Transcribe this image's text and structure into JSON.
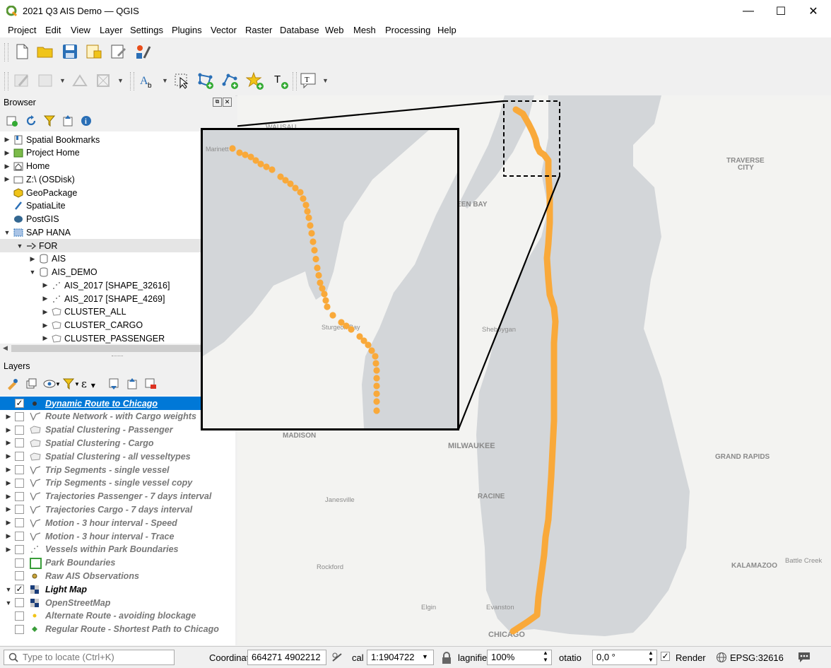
{
  "window": {
    "title": "2021 Q3 AIS Demo — QGIS",
    "minimize": "—",
    "maximize": "☐",
    "close": "✕"
  },
  "menu": [
    "Project",
    "Edit",
    "View",
    "Layer",
    "Settings",
    "Plugins",
    "Vector",
    "Raster",
    "Database",
    "Web",
    "Mesh",
    "Processing",
    "Help"
  ],
  "browser": {
    "title": "Browser",
    "items": [
      {
        "label": "Spatial Bookmarks",
        "icon": "bookmark-icon",
        "expander": "▶",
        "indent": 0
      },
      {
        "label": "Project Home",
        "icon": "project-home-icon",
        "expander": "▶",
        "indent": 0
      },
      {
        "label": "Home",
        "icon": "home-folder-icon",
        "expander": "▶",
        "indent": 0
      },
      {
        "label": "Z:\\ (OSDisk)",
        "icon": "drive-icon",
        "expander": "▶",
        "indent": 0
      },
      {
        "label": "GeoPackage",
        "icon": "geopackage-icon",
        "expander": "",
        "indent": 0
      },
      {
        "label": "SpatiaLite",
        "icon": "spatialite-icon",
        "expander": "",
        "indent": 0
      },
      {
        "label": "PostGIS",
        "icon": "postgis-icon",
        "expander": "",
        "indent": 0
      },
      {
        "label": "SAP HANA",
        "icon": "sap-hana-icon",
        "expander": "▼",
        "indent": 0
      },
      {
        "label": "FOR",
        "icon": "connection-icon",
        "expander": "▼",
        "indent": 1
      },
      {
        "label": "AIS",
        "icon": "schema-icon",
        "expander": "▶",
        "indent": 2
      },
      {
        "label": "AIS_DEMO",
        "icon": "schema-icon",
        "expander": "▼",
        "indent": 2
      },
      {
        "label": "AIS_2017 [SHAPE_32616]",
        "icon": "point-layer-icon",
        "expander": "▶",
        "indent": 3
      },
      {
        "label": "AIS_2017 [SHAPE_4269]",
        "icon": "point-layer-icon",
        "expander": "▶",
        "indent": 3
      },
      {
        "label": "CLUSTER_ALL",
        "icon": "polygon-layer-icon",
        "expander": "▶",
        "indent": 3
      },
      {
        "label": "CLUSTER_CARGO",
        "icon": "polygon-layer-icon",
        "expander": "▶",
        "indent": 3
      },
      {
        "label": "CLUSTER_PASSENGER",
        "icon": "polygon-layer-icon",
        "expander": "▶",
        "indent": 3
      }
    ]
  },
  "layers": {
    "title": "Layers",
    "items": [
      {
        "label": "Dynamic Route to Chicago",
        "checked": true,
        "expander": "",
        "icon": "point-symbol-icon",
        "state": "sel"
      },
      {
        "label": "Route Network - with Cargo weights",
        "checked": false,
        "expander": "▶",
        "icon": "line-icon",
        "state": "off"
      },
      {
        "label": "Spatial Clustering - Passenger",
        "checked": false,
        "expander": "▶",
        "icon": "polygon-icon",
        "state": "off"
      },
      {
        "label": "Spatial Clustering - Cargo",
        "checked": false,
        "expander": "▶",
        "icon": "polygon-icon",
        "state": "off"
      },
      {
        "label": "Spatial Clustering - all vesseltypes",
        "checked": false,
        "expander": "▶",
        "icon": "polygon-icon",
        "state": "off"
      },
      {
        "label": "Trip Segments - single vessel",
        "checked": false,
        "expander": "▶",
        "icon": "line-icon",
        "state": "off"
      },
      {
        "label": "Trip Segments - single vessel copy",
        "checked": false,
        "expander": "▶",
        "icon": "line-icon",
        "state": "off"
      },
      {
        "label": "Trajectories Passenger - 7 days interval",
        "checked": false,
        "expander": "▶",
        "icon": "line-icon",
        "state": "off"
      },
      {
        "label": "Trajectories Cargo - 7 days interval",
        "checked": false,
        "expander": "▶",
        "icon": "line-icon",
        "state": "off"
      },
      {
        "label": "Motion - 3 hour interval - Speed",
        "checked": false,
        "expander": "▶",
        "icon": "line-icon",
        "state": "off"
      },
      {
        "label": "Motion - 3 hour interval - Trace",
        "checked": false,
        "expander": "▶",
        "icon": "line-icon",
        "state": "off"
      },
      {
        "label": "Vessels within Park Boundaries",
        "checked": false,
        "expander": "▶",
        "icon": "points-icon",
        "state": "off"
      },
      {
        "label": "Park Boundaries",
        "checked": false,
        "expander": "",
        "icon": "green-square-icon",
        "state": "off"
      },
      {
        "label": "Raw AIS Observations",
        "checked": false,
        "expander": "",
        "icon": "brown-dot-icon",
        "state": "off"
      },
      {
        "label": "Light Map",
        "checked": true,
        "expander": "▼",
        "icon": "raster-icon",
        "state": "on"
      },
      {
        "label": "OpenStreetMap",
        "checked": false,
        "expander": "▼",
        "icon": "raster-icon",
        "state": "off"
      },
      {
        "label": "Alternate Route - avoiding blockage",
        "checked": false,
        "expander": "",
        "icon": "yellow-dot-icon",
        "state": "off"
      },
      {
        "label": "Regular Route - Shortest Path to Chicago",
        "checked": false,
        "expander": "",
        "icon": "green-diamond-icon",
        "state": "off"
      }
    ]
  },
  "map_labels": {
    "wausau": "WAUSAU",
    "green_bay": "EEN BAY",
    "traverse_city_1": "TRAVERSE",
    "traverse_city_2": "CITY",
    "sheboygan": "Sheboygan",
    "madison": "MADISON",
    "milwaukee": "MILWAUKEE",
    "racine": "RACINE",
    "janesville": "Janesville",
    "grand_rapids": "GRAND RAPIDS",
    "rockford": "Rockford",
    "kalamazoo": "KALAMAZOO",
    "battle_creek": "Battle Creek",
    "elgin": "Elgin",
    "evanston": "Evanston",
    "chicago": "CHICAGO",
    "marinette": "Marinett",
    "sturgeon_bay": "Sturgeon Bay"
  },
  "status": {
    "locate_placeholder": "Type to locate (Ctrl+K)",
    "coordinate_label": "Coordinat",
    "coordinate_value": "664271 4902212",
    "scale_label": "cal",
    "scale_value": "1:1904722",
    "magnifier_label": "lagnifie",
    "magnifier_value": "100%",
    "rotation_label": "otatio",
    "rotation_value": "0,0 °",
    "render_label": "Render",
    "crs": "EPSG:32616"
  },
  "colors": {
    "route": "#f9a93a",
    "water": "#d3d6d9",
    "land": "#f3f3f1",
    "selection": "#0078d7"
  }
}
